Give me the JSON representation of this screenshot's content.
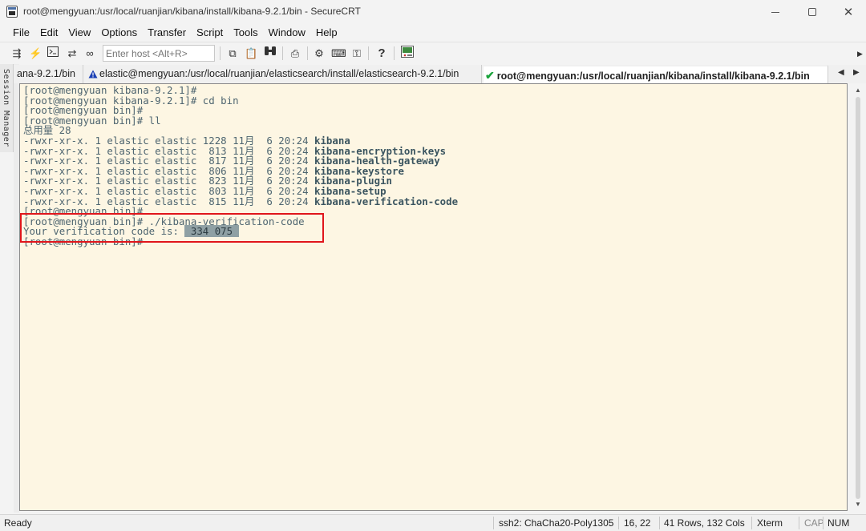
{
  "window": {
    "title": "root@mengyuan:/usr/local/ruanjian/kibana/install/kibana-9.2.1/bin - SecureCRT",
    "minimize": "–",
    "maximize": "☐",
    "close": "✕"
  },
  "menu": [
    "File",
    "Edit",
    "View",
    "Options",
    "Transfer",
    "Script",
    "Tools",
    "Window",
    "Help"
  ],
  "toolbar": {
    "host_placeholder": "Enter host <Alt+R>",
    "icons": [
      "connect-icon",
      "lightning-icon",
      "terminal-icon",
      "reconnect-icon",
      "link-icon",
      "copy-icon",
      "paste-icon",
      "find-icon",
      "print-icon",
      "settings-icon",
      "keymap-icon",
      "key-icon",
      "help-icon",
      "screen-icon"
    ]
  },
  "session_manager": {
    "label": "Session Manager"
  },
  "tabs": [
    {
      "label": "ana-9.2.1/bin",
      "status": "none"
    },
    {
      "label": "elastic@mengyuan:/usr/local/ruanjian/elasticsearch/install/elasticsearch-9.2.1/bin",
      "status": "warning"
    },
    {
      "label": "root@mengyuan:/usr/local/ruanjian/kibana/install/kibana-9.2.1/bin",
      "status": "connected"
    }
  ],
  "terminal": {
    "lines": [
      {
        "text": "[root@mengyuan kibana-9.2.1]#"
      },
      {
        "text": "[root@mengyuan kibana-9.2.1]# cd bin"
      },
      {
        "text": "[root@mengyuan bin]#"
      },
      {
        "text": "[root@mengyuan bin]# ll"
      },
      {
        "text": "总用量 28"
      },
      {
        "prefix": "-rwxr-xr-x. 1 elastic elastic 1228 11月  6 20:24 ",
        "file": "kibana"
      },
      {
        "prefix": "-rwxr-xr-x. 1 elastic elastic  813 11月  6 20:24 ",
        "file": "kibana-encryption-keys"
      },
      {
        "prefix": "-rwxr-xr-x. 1 elastic elastic  817 11月  6 20:24 ",
        "file": "kibana-health-gateway"
      },
      {
        "prefix": "-rwxr-xr-x. 1 elastic elastic  806 11月  6 20:24 ",
        "file": "kibana-keystore"
      },
      {
        "prefix": "-rwxr-xr-x. 1 elastic elastic  823 11月  6 20:24 ",
        "file": "kibana-plugin"
      },
      {
        "prefix": "-rwxr-xr-x. 1 elastic elastic  803 11月  6 20:24 ",
        "file": "kibana-setup"
      },
      {
        "prefix": "-rwxr-xr-x. 1 elastic elastic  815 11月  6 20:24 ",
        "file": "kibana-verification-code"
      },
      {
        "text": "[root@mengyuan bin]#"
      },
      {
        "text": "[root@mengyuan bin]# ./kibana-verification-code"
      },
      {
        "prefix": "Your verification code is: ",
        "code": " 334 075 "
      },
      {
        "text": "[root@mengyuan bin]#"
      }
    ]
  },
  "statusbar": {
    "ready": "Ready",
    "cipher": "ssh2: ChaCha20-Poly1305",
    "cursor": "16,  22",
    "size": "41 Rows, 132 Cols",
    "emulation": "Xterm",
    "cap": "CAP",
    "num": "NUM"
  },
  "colors": {
    "terminal_bg": "#fdf6e3",
    "terminal_fg": "#4e6570",
    "highlight_box": "#e0161c",
    "connected": "#1aa33b",
    "warning": "#1a3fb4"
  }
}
